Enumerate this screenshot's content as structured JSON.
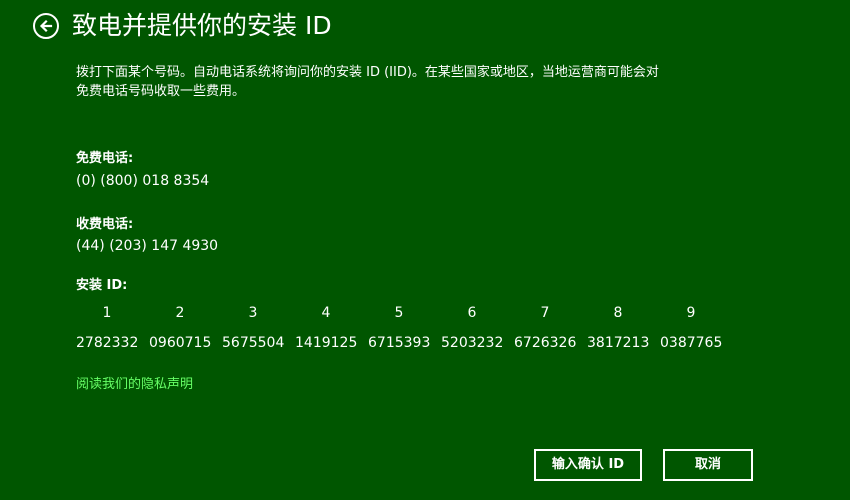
{
  "header": {
    "back_icon": "back-arrow-icon",
    "title": "致电并提供你的安装 ID"
  },
  "intro": {
    "line1": "拨打下面某个号码。自动电话系统将询问你的安装 ID (IID)。在某些国家或地区，当地运营商可能会对",
    "line2": "免费电话号码收取一些费用。"
  },
  "toll_free": {
    "label": "免费电话:",
    "number": "(0) (800) 018 8354"
  },
  "toll": {
    "label": "收费电话:",
    "number": "(44) (203) 147 4930"
  },
  "installation_id": {
    "label": "安装 ID:",
    "columns": [
      "1",
      "2",
      "3",
      "4",
      "5",
      "6",
      "7",
      "8",
      "9"
    ],
    "groups": [
      "2782332",
      "0960715",
      "5675504",
      "1419125",
      "6715393",
      "5203232",
      "6726326",
      "3817213",
      "0387765"
    ]
  },
  "privacy_link": "阅读我们的隐私声明",
  "buttons": {
    "confirm": "输入确认 ID",
    "cancel": "取消"
  }
}
